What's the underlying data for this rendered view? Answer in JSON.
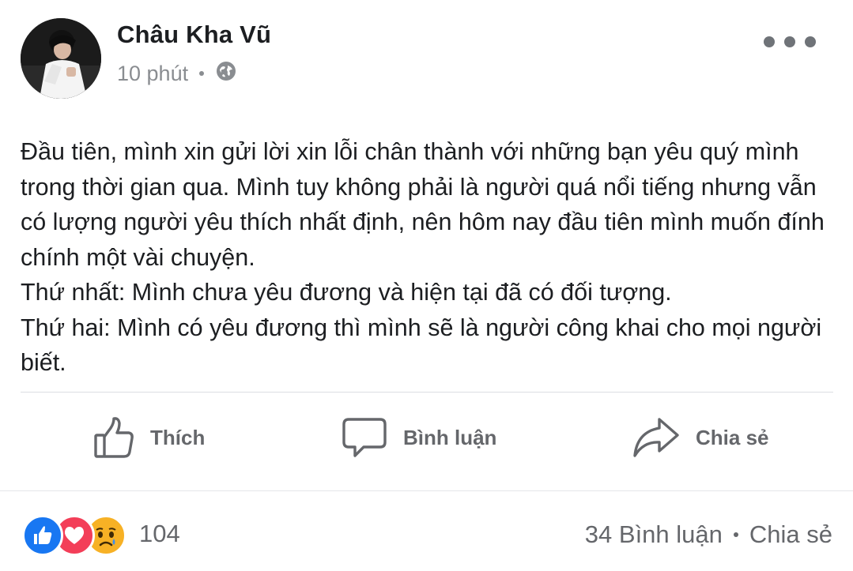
{
  "post": {
    "author": "Châu Kha Vũ",
    "time": "10 phút",
    "privacy_icon": "globe-icon",
    "more_icon": "more-horizontal-icon",
    "paragraphs": [
      "Đầu tiên, mình xin gửi lời xin lỗi chân thành với những bạn yêu quý mình trong thời gian qua. Mình tuy không phải là người quá nổi tiếng nhưng vẫn có lượng người yêu thích nhất định, nên hôm nay đầu tiên mình muốn đính chính một vài chuyện.",
      "Thứ nhất: Mình chưa yêu đương và hiện tại đã có đối tượng.",
      "Thứ hai: Mình có yêu đương thì mình sẽ là người công khai cho mọi người biết."
    ]
  },
  "actions": {
    "like": "Thích",
    "comment": "Bình luận",
    "share": "Chia sẻ"
  },
  "stats": {
    "reactions": [
      "like",
      "love",
      "sad"
    ],
    "reaction_count": "104",
    "comments": "34 Bình luận",
    "shares": "Chia sẻ"
  },
  "colors": {
    "like": "#1877f2",
    "love": "#f33e58",
    "sad": "#f7b125",
    "secondary_text": "#65676b"
  }
}
